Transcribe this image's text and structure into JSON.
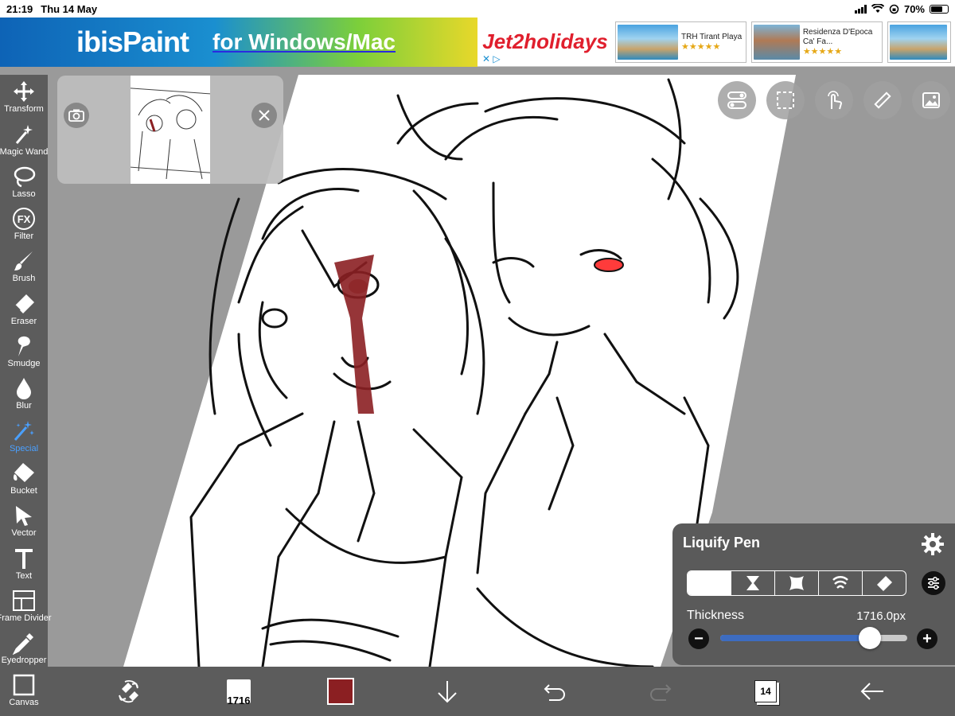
{
  "status_bar": {
    "time": "21:19",
    "date": "Thu 14 May",
    "battery": "70%"
  },
  "ad": {
    "ibis_logo": "ibisPaint",
    "ibis_tagline": "for Windows/Mac",
    "jet2_brand": "Jet2holidays",
    "hotels": [
      {
        "name": "TRH Tirant Playa",
        "stars": "★★★★★"
      },
      {
        "name": "Residenza D'Epoca Ca' Fa...",
        "stars": "★★★★★"
      },
      {
        "name": "",
        "stars": ""
      }
    ]
  },
  "toolbar": {
    "items": [
      {
        "label": "Transform",
        "icon": "move-arrows-icon"
      },
      {
        "label": "Magic Wand",
        "icon": "magic-wand-icon"
      },
      {
        "label": "Lasso",
        "icon": "lasso-icon"
      },
      {
        "label": "Filter",
        "icon": "fx-icon"
      },
      {
        "label": "Brush",
        "icon": "brush-icon"
      },
      {
        "label": "Eraser",
        "icon": "eraser-icon"
      },
      {
        "label": "Smudge",
        "icon": "smudge-icon"
      },
      {
        "label": "Blur",
        "icon": "blur-drop-icon"
      },
      {
        "label": "Special",
        "icon": "special-wand-icon"
      },
      {
        "label": "Bucket",
        "icon": "bucket-icon"
      },
      {
        "label": "Vector",
        "icon": "vector-cursor-icon"
      },
      {
        "label": "Text",
        "icon": "text-icon"
      },
      {
        "label": "Frame Divider",
        "icon": "frame-divider-icon"
      },
      {
        "label": "Eyedropper",
        "icon": "eyedropper-icon"
      },
      {
        "label": "Canvas",
        "icon": "canvas-icon"
      }
    ],
    "active": "Special",
    "active_color": "#4aa0ff"
  },
  "liquify": {
    "title": "Liquify Pen",
    "modes": [
      "swirl-left-icon",
      "pinch-icon",
      "expand-icon",
      "wave-icon",
      "eraser-icon"
    ],
    "selected_mode": 0,
    "thickness_label": "Thickness",
    "thickness_value": "1716.0px",
    "thickness_fraction": 0.8
  },
  "bottom_bar": {
    "brush_size": "1716",
    "color": "#8b1f22",
    "layer_count": "14"
  },
  "colors": {
    "toolbar_bg": "#5c5c5c",
    "canvas_bg": "#9a9a9a",
    "accent": "#3d6cc0",
    "blood_red": "#8b1f22",
    "cheek_red": "#ff3b3b"
  }
}
